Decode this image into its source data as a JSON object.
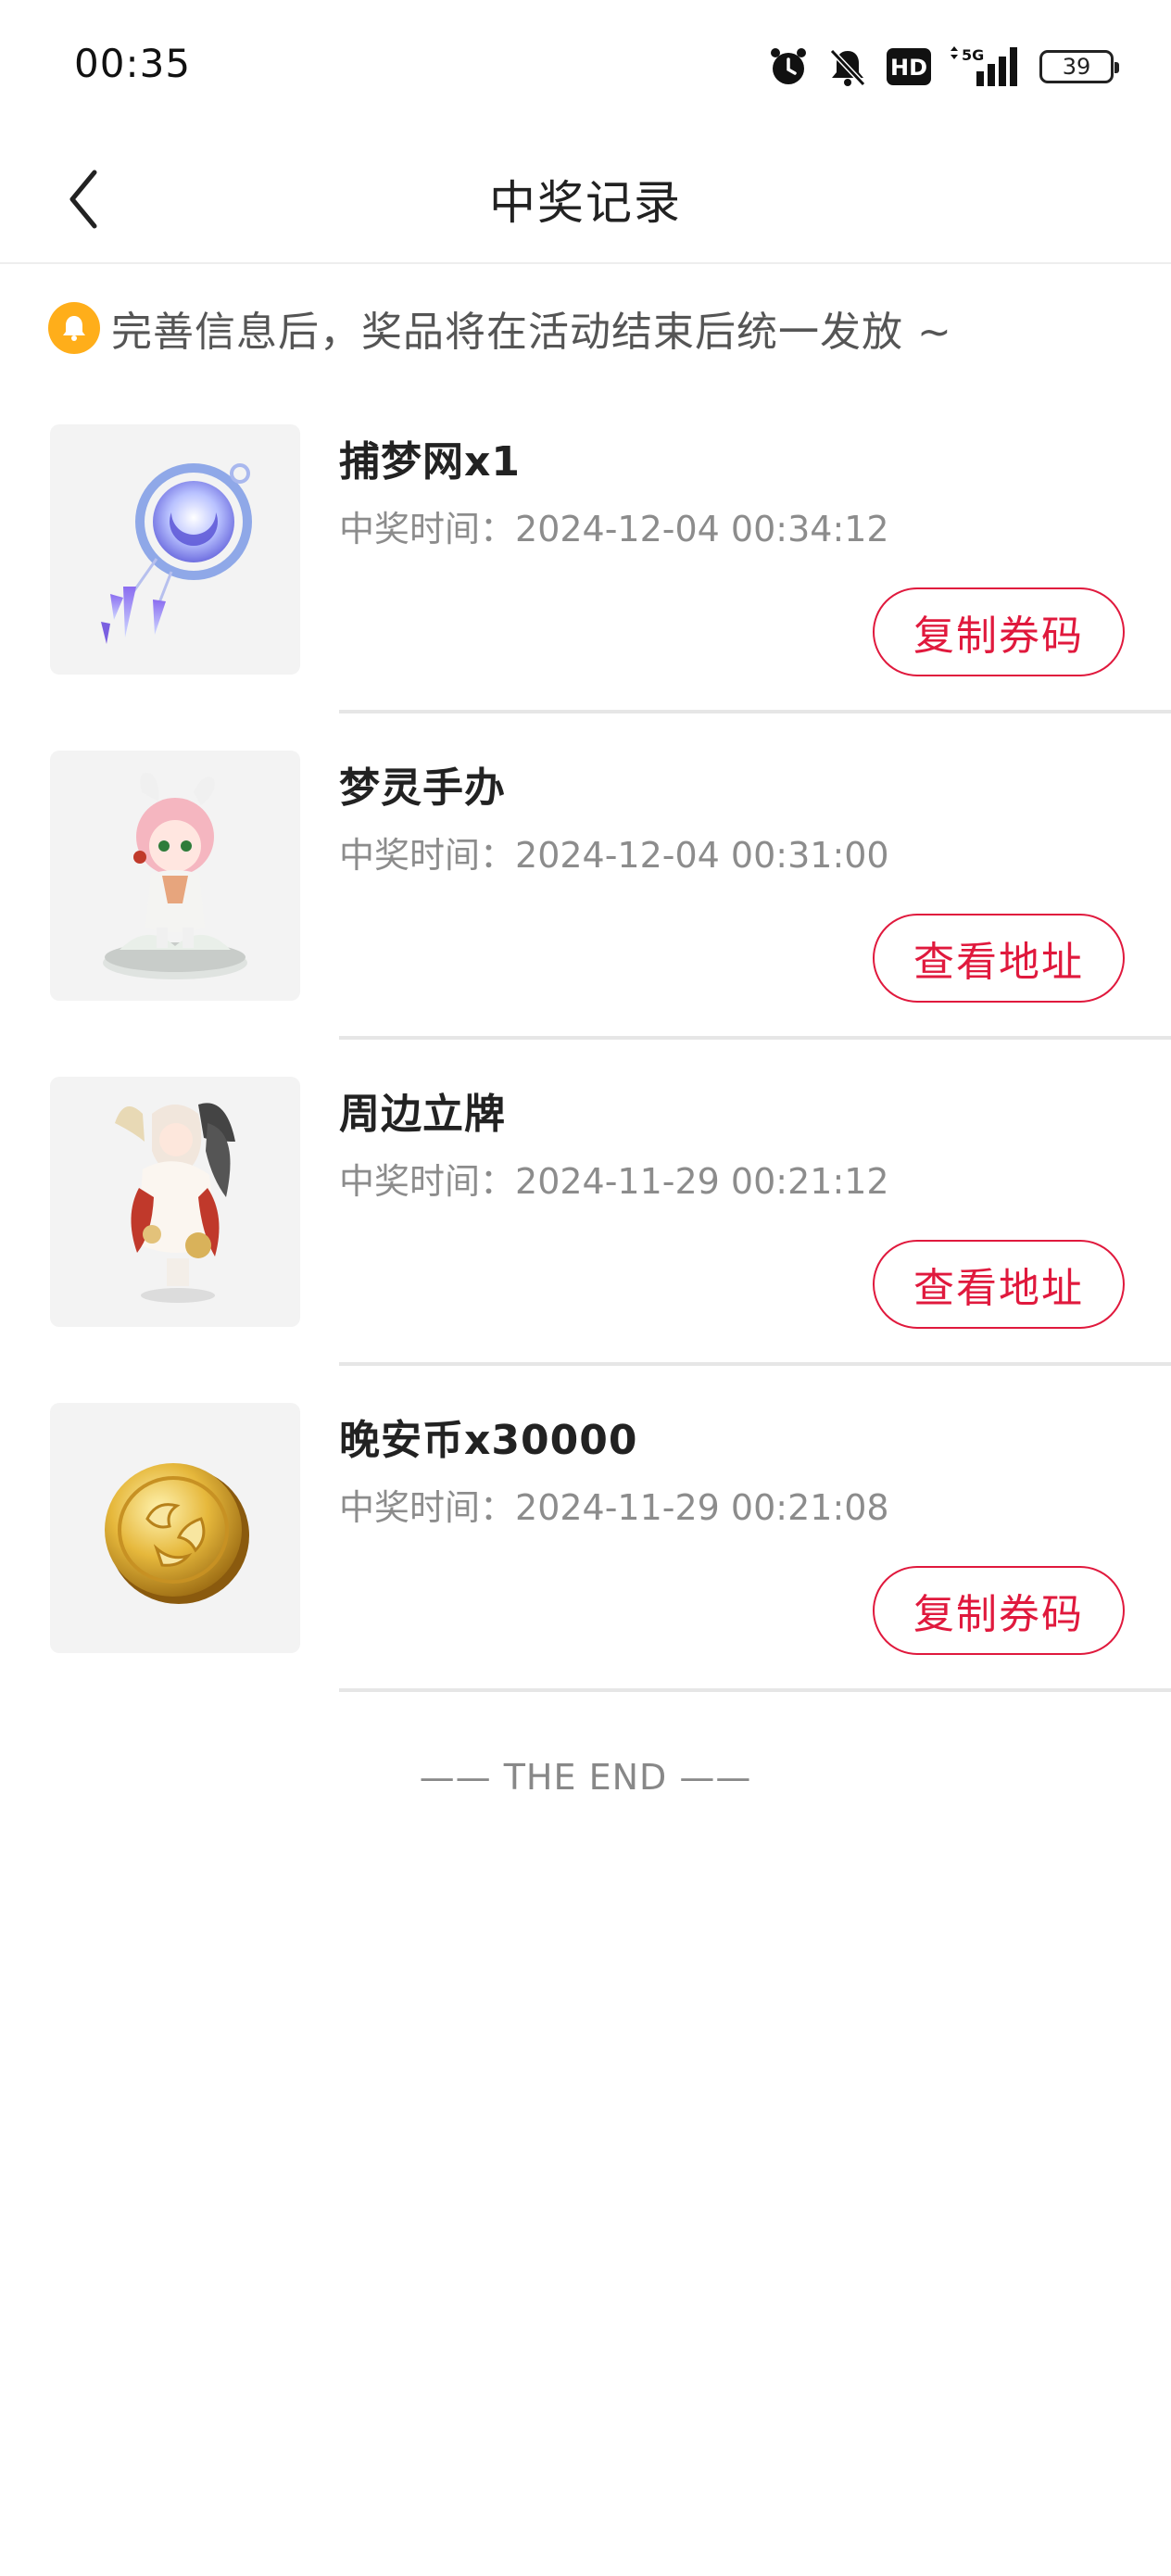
{
  "status_bar": {
    "time": "00:35",
    "network": "5G",
    "hd_label": "HD",
    "battery": "39",
    "icons": [
      "alarm-icon",
      "mute-icon",
      "hd-icon",
      "signal-5g-icon",
      "battery-icon"
    ]
  },
  "nav": {
    "back_icon": "chevron-left-icon",
    "title": "中奖记录"
  },
  "notice": {
    "icon": "bell-icon",
    "text": "完善信息后，奖品将在活动结束后统一发放 ~"
  },
  "prizes": [
    {
      "name": "捕梦网x1",
      "time_label": "中奖时间：",
      "time": "2024-12-04 00:34:12",
      "action": "复制券码",
      "image": "dreamcatcher-image"
    },
    {
      "name": "梦灵手办",
      "time_label": "中奖时间：",
      "time": "2024-12-04 00:31:00",
      "action": "查看地址",
      "image": "figure-image"
    },
    {
      "name": "周边立牌",
      "time_label": "中奖时间：",
      "time": "2024-11-29 00:21:12",
      "action": "查看地址",
      "image": "acrylic-stand-image"
    },
    {
      "name": "晚安币x30000",
      "time_label": "中奖时间：",
      "time": "2024-11-29 00:21:08",
      "action": "复制券码",
      "image": "coin-image"
    }
  ],
  "footer": {
    "end_text": "—— THE END ——"
  },
  "colors": {
    "accent": "#e0193d",
    "notice_icon": "#ffae1a",
    "divider": "#e6e6e6"
  }
}
